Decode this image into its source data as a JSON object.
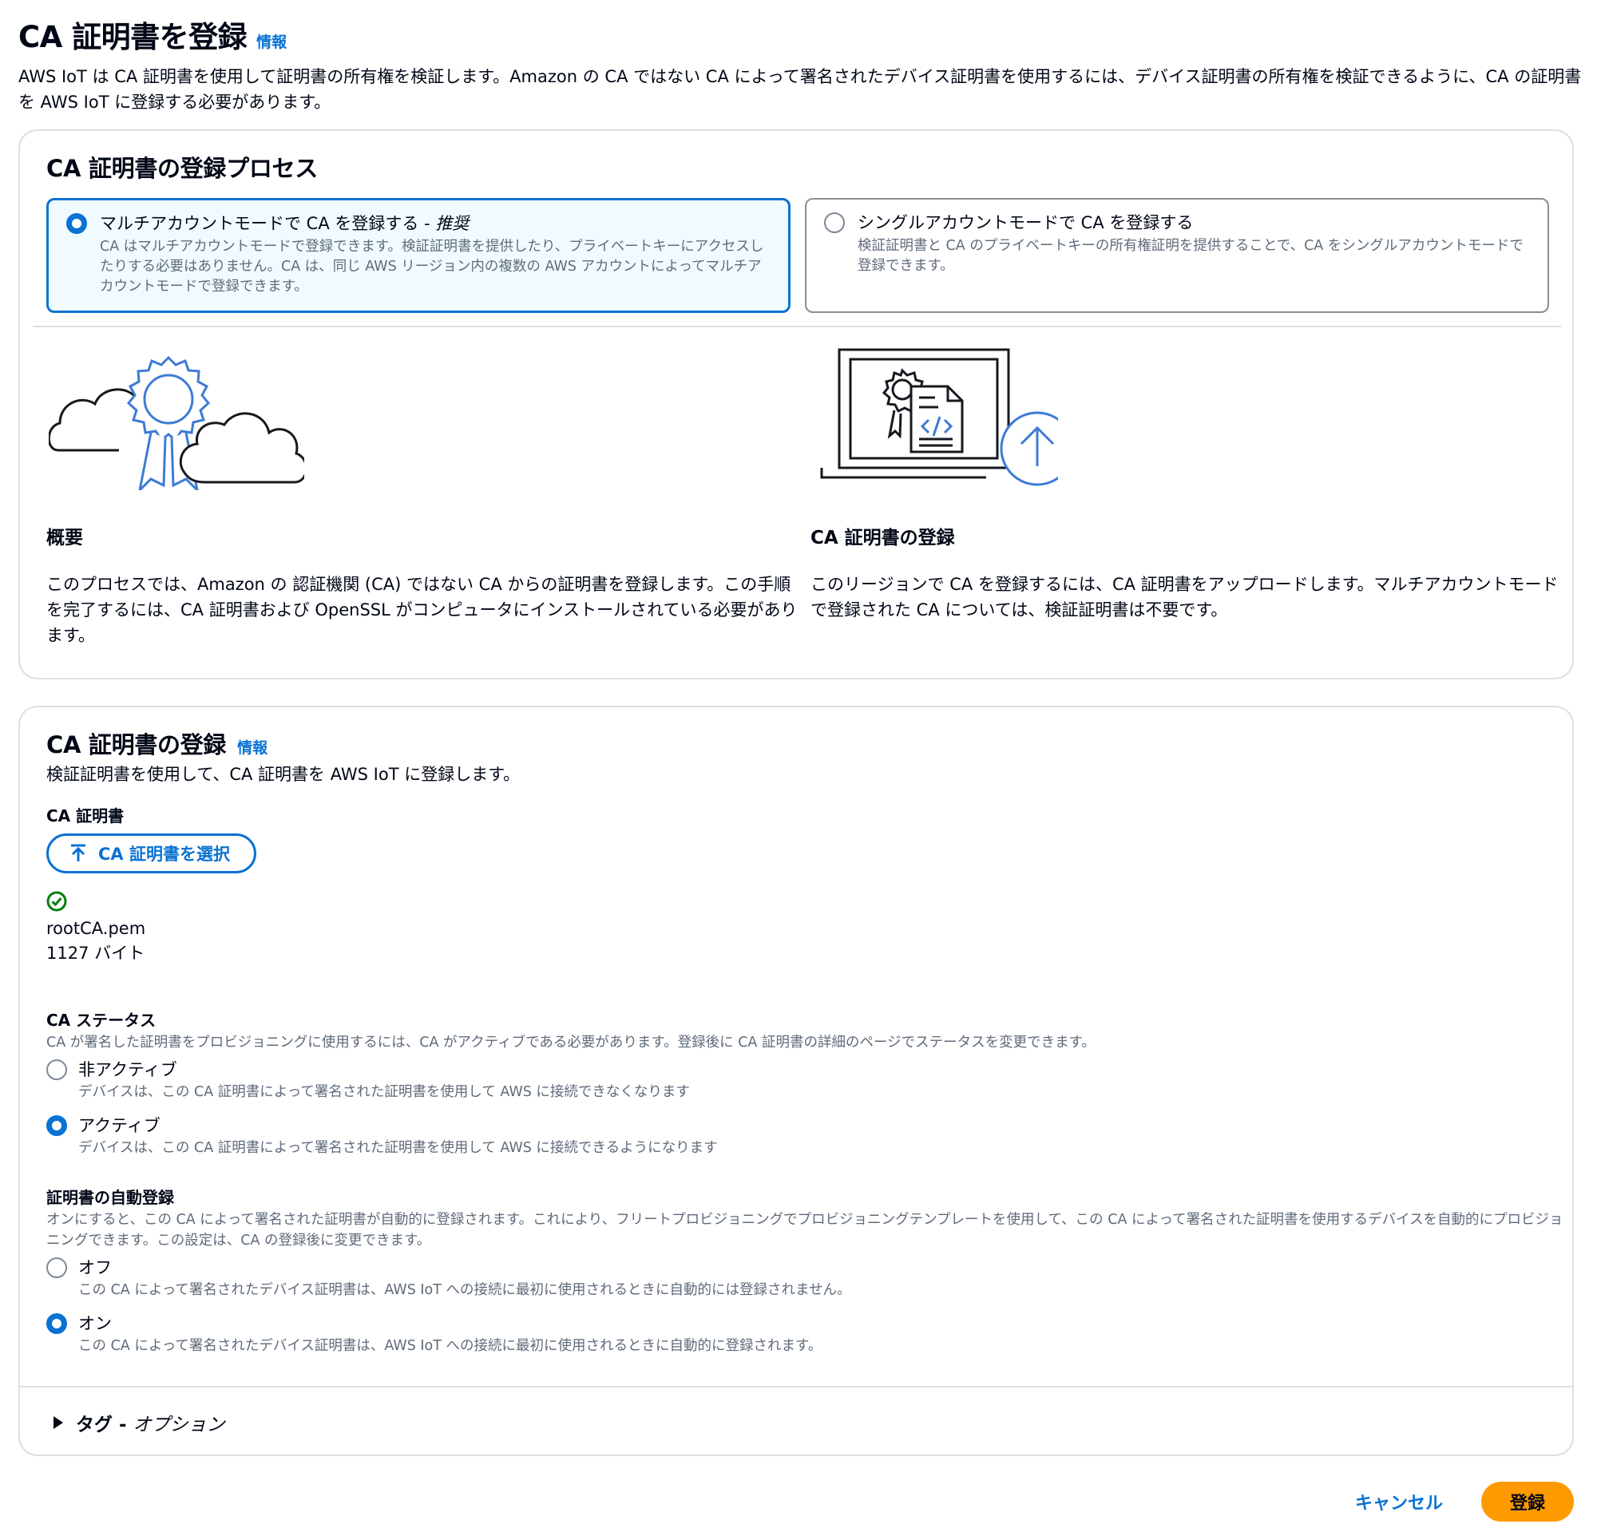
{
  "header": {
    "title": "CA 証明書を登録",
    "info": "情報",
    "description": "AWS IoT は CA 証明書を使用して証明書の所有権を検証します。Amazon の CA ではない CA によって署名されたデバイス証明書を使用するには、デバイス証明書の所有権を検証できるように、CA の証明書を AWS IoT に登録する必要があります。"
  },
  "process": {
    "title": "CA 証明書の登録プロセス",
    "multi": {
      "label": "マルチアカウントモードで CA を登録する - ",
      "label_em": "推奨",
      "description": "CA はマルチアカウントモードで登録できます。検証証明書を提供したり、プライベートキーにアクセスしたりする必要はありません。CA は、同じ AWS リージョン内の複数の AWS アカウントによってマルチアカウントモードで登録できます。",
      "selected": true
    },
    "single": {
      "label": "シングルアカウントモードで CA を登録する",
      "description": "検証証明書と CA のプライベートキーの所有権証明を提供することで、CA をシングルアカウントモードで登録できます。",
      "selected": false
    },
    "overview": {
      "heading": "概要",
      "body": "このプロセスでは、Amazon の 認証機関 (CA) ではない CA からの証明書を登録します。この手順を完了するには、CA 証明書および OpenSSL がコンピュータにインストールされている必要があります。",
      "icon": "cloud-certificate-icon"
    },
    "register": {
      "heading": "CA 証明書の登録",
      "body": "このリージョンで CA を登録するには、CA 証明書をアップロードします。マルチアカウントモードで登録された CA については、検証証明書は不要です。",
      "icon": "laptop-upload-icon"
    }
  },
  "registration": {
    "title": "CA 証明書の登録",
    "info": "情報",
    "description": "検証証明書を使用して、CA 証明書を AWS IoT に登録します。",
    "ca_cert": {
      "label": "CA 証明書",
      "button": "CA 証明書を選択",
      "file_name": "rootCA.pem",
      "file_size": "1127 バイト"
    },
    "status": {
      "label": "CA ステータス",
      "description": "CA が署名した証明書をプロビジョニングに使用するには、CA がアクティブである必要があります。登録後に CA 証明書の詳細のページでステータスを変更できます。",
      "options": [
        {
          "label": "非アクティブ",
          "description": "デバイスは、この CA 証明書によって署名された証明書を使用して AWS に接続できなくなります",
          "selected": false
        },
        {
          "label": "アクティブ",
          "description": "デバイスは、この CA 証明書によって署名された証明書を使用して AWS に接続できるようになります",
          "selected": true
        }
      ]
    },
    "auto": {
      "label": "証明書の自動登録",
      "description": "オンにすると、この CA によって署名された証明書が自動的に登録されます。これにより、フリートプロビジョニングでプロビジョニングテンプレートを使用して、この CA によって署名された証明書を使用するデバイスを自動的にプロビジョニングできます。この設定は、CA の登録後に変更できます。",
      "options": [
        {
          "label": "オフ",
          "description": "この CA によって署名されたデバイス証明書は、AWS IoT への接続に最初に使用されるときに自動的には登録されません。",
          "selected": false
        },
        {
          "label": "オン",
          "description": "この CA によって署名されたデバイス証明書は、AWS IoT への接続に最初に使用されるときに自動的に登録されます。",
          "selected": true
        }
      ]
    },
    "tags": {
      "label": "タグ - ",
      "optional": "オプション"
    }
  },
  "footer": {
    "cancel": "キャンセル",
    "submit": "登録"
  },
  "colors": {
    "accent": "#0972d3",
    "primary_button": "#ff9900",
    "success": "#037f0c"
  }
}
